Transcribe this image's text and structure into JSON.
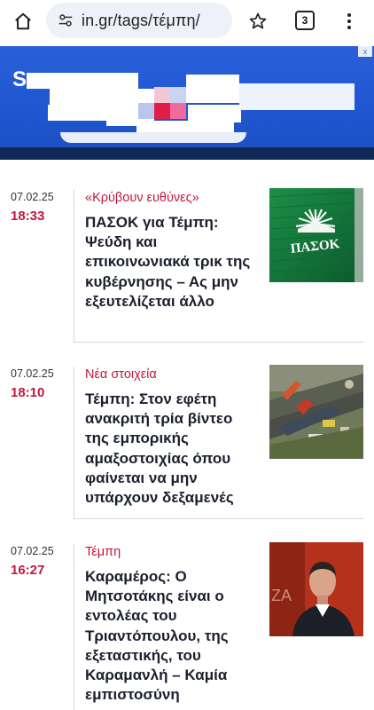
{
  "browser": {
    "url": "in.gr/tags/τέμπη/",
    "tab_count": "3",
    "icons": [
      "home-icon",
      "site-settings-icon",
      "star-icon",
      "tabs-icon",
      "more-vert-icon"
    ]
  },
  "ad": {
    "logo_text": "S",
    "close_label": "x",
    "colors": {
      "background": "#2a5fd9",
      "strip": "#0e2a55"
    }
  },
  "articles": [
    {
      "date": "07.02.25",
      "time": "18:33",
      "category": "«Κρύβουν ευθύνες»",
      "title": "ΠΑΣΟΚ για Τέμπη: Ψεύδη και επικοινωνιακά τρικ της κυβέρνησης – Ας μην εξευτελίζεται άλλο",
      "thumb_text": "ΠΑΣΟΚ"
    },
    {
      "date": "07.02.25",
      "time": "18:10",
      "category": "Νέα στοιχεία",
      "title": "Τέμπη: Στον εφέτη ανακριτή τρία βίντεο της εμπορικής αμαξοστοιχίας όπου φαίνεται να μην υπάρχουν δεξαμενές",
      "thumb_text": ""
    },
    {
      "date": "07.02.25",
      "time": "16:27",
      "category": "Τέμπη",
      "title": "Καραμέρος: Ο Μητσοτάκης είναι ο εντολέας του Τριαντόπουλου, της εξεταστικής, του Καραμανλή – Καμία εμπιστοσύνη",
      "thumb_text": "ΖΑ"
    }
  ],
  "colors": {
    "accent": "#c3163c",
    "title": "#1a1f2e"
  }
}
